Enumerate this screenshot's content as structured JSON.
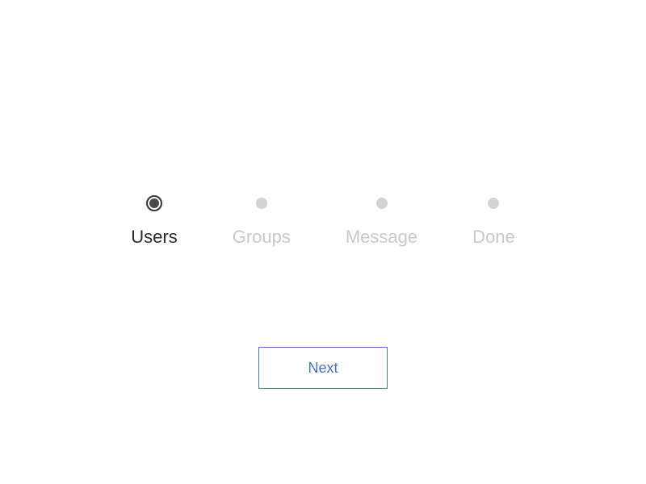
{
  "wizard": {
    "steps": [
      {
        "label": "Users",
        "active": true
      },
      {
        "label": "Groups",
        "active": false
      },
      {
        "label": "Message",
        "active": false
      },
      {
        "label": "Done",
        "active": false
      }
    ],
    "next_label": "Next"
  }
}
